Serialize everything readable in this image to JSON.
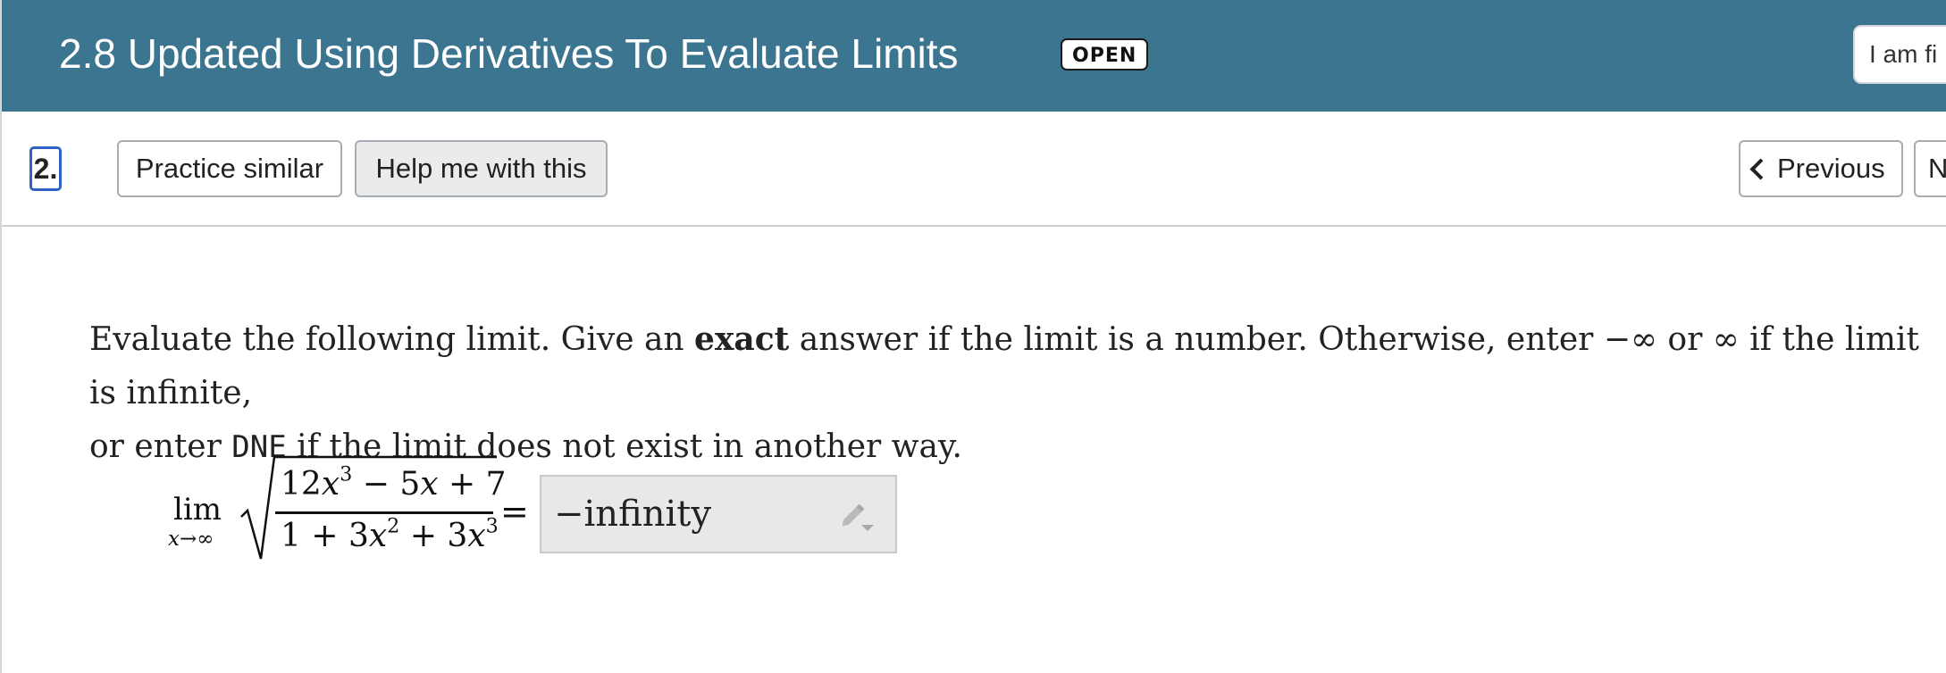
{
  "header": {
    "title": "2.8 Updated Using Derivatives To Evaluate Limits",
    "status_badge": "OPEN",
    "menu_button_label": "I am fi"
  },
  "toolbar": {
    "question_number": "2.",
    "practice_similar_label": "Practice similar",
    "help_label": "Help me with this",
    "previous_label": "Previous",
    "next_label": "N"
  },
  "problem": {
    "part1": "Evaluate the following limit. Give an ",
    "bold": "exact",
    "part2": " answer if the limit is a number. Otherwise, enter −∞ or ∞ if the limit is infinite,",
    "part3": "or enter ",
    "code": "DNE",
    "part4": " if the limit does not exist in another way."
  },
  "math": {
    "lim": "lim",
    "lim_sub": "x→∞",
    "equals": "=",
    "numerator": {
      "c1": "12",
      "v1": "x",
      "p1": "3",
      "op1": " − 5",
      "v2": "x",
      "op2": " + 7"
    },
    "denominator": {
      "c0": "1 + 3",
      "v1": "x",
      "p1": "2",
      "op1": " + 3",
      "v2": "x",
      "p2": "3"
    }
  },
  "answer": {
    "value": "−infinity",
    "edit_icon": "pencil-dropdown-icon"
  },
  "colors": {
    "header_bg": "#3c7590",
    "focus_outline": "#2f62c4",
    "answer_bg": "#e8e8e8"
  }
}
